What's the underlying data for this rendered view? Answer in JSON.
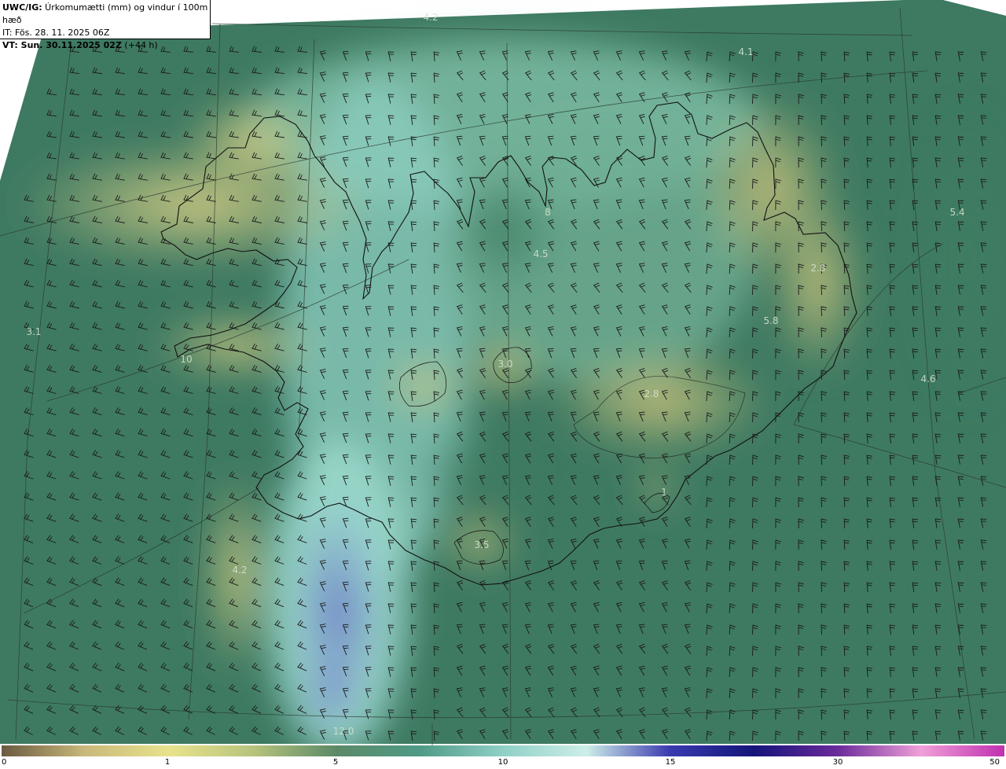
{
  "header": {
    "line1_bold": "UWC/IG:",
    "line1_text": " Úrkomumætti (mm) og vindur í 100m hæð",
    "line2": "IT: Fös. 28. 11. 2025 06Z",
    "line3_bold": "VT: Sun. 30.11.2025 02Z",
    "line3_text": " (+44 h)"
  },
  "map_labels": [
    "4.2",
    "4.1",
    "5.4",
    "2.8",
    "4.5",
    "8",
    "3.1",
    "10",
    "3.0",
    "5.8",
    "2.8",
    "4.6",
    "1",
    "3.5",
    "4.2",
    "12.0"
  ],
  "colorbar": {
    "ticks": [
      "0",
      "1",
      "5",
      "10",
      "15",
      "30",
      "50"
    ],
    "colors": [
      "#6b5a40",
      "#c9b97a",
      "#e8e28c",
      "#b8c47c",
      "#5c8a68",
      "#4f9a86",
      "#8fd0c6",
      "#cdeee8",
      "#3a3ab0",
      "#14147a",
      "#6a2a9a",
      "#f0a0d8",
      "#c030b0"
    ]
  },
  "colors": {
    "sea_deep": "#3e7a62",
    "land_low": "#6c9a6c",
    "land_high": "#c8c880",
    "precip_band": "#8ecfc2",
    "precip_heavy": "#7d8ed0"
  }
}
